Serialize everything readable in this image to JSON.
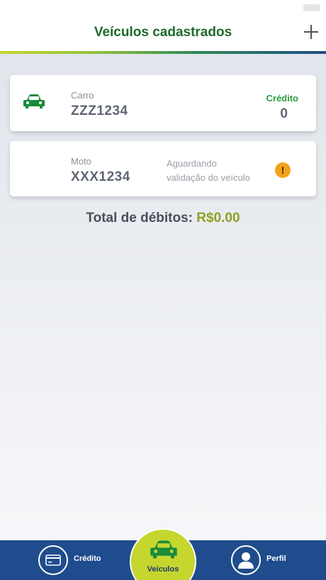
{
  "header": {
    "title": "Veículos cadastrados"
  },
  "vehicles": [
    {
      "type": "Carro",
      "plate": "ZZZ1234",
      "credit_label": "Crédito",
      "credit_value": "0",
      "icon": "car-icon"
    },
    {
      "type": "Moto",
      "plate": "XXX1234",
      "status_text_line1": "Aguardando",
      "status_text_line2": "validação do veículo",
      "status_icon": "warning-icon"
    }
  ],
  "summary": {
    "label": "Total de débitos:",
    "amount": "R$0.00"
  },
  "bottom_nav": {
    "credit_label": "Crédito",
    "vehicles_label": "Veículos",
    "profile_label": "Perfil"
  },
  "colors": {
    "brand_green": "#1d6b2b",
    "accent_lime": "#c5d62f",
    "nav_blue": "#1f4c8d",
    "warning": "#f2a21c"
  }
}
